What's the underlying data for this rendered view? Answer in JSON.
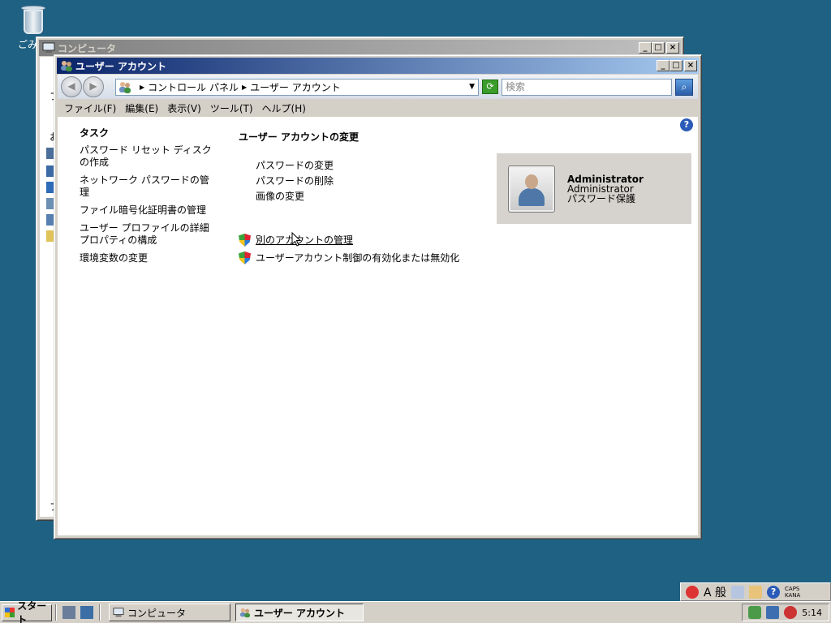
{
  "desktop": {
    "recycle_bin_label": "ごみ箱"
  },
  "back_window": {
    "title": "コンピュータ",
    "sliver_texts": [
      "フ",
      "お",
      "フ"
    ]
  },
  "window": {
    "title": "ユーザー アカウント",
    "controls": {
      "minimize": "_",
      "maximize": "□",
      "close": "×"
    }
  },
  "address_bar": {
    "crumbs": [
      "コントロール パネル",
      "ユーザー アカウント"
    ],
    "search_placeholder": "検索"
  },
  "menu": {
    "items": [
      "ファイル(F)",
      "編集(E)",
      "表示(V)",
      "ツール(T)",
      "ヘルプ(H)"
    ]
  },
  "tasks": {
    "heading": "タスク",
    "items": [
      "パスワード リセット ディスクの作成",
      "ネットワーク パスワードの管理",
      "ファイル暗号化証明書の管理",
      "ユーザー プロファイルの詳細プロパティの構成",
      "環境変数の変更"
    ]
  },
  "main": {
    "heading": "ユーザー アカウントの変更",
    "actions": [
      "パスワードの変更",
      "パスワードの削除",
      "画像の変更"
    ],
    "shield_actions": [
      "別のアカウントの管理",
      "ユーザーアカウント制御の有効化または無効化"
    ]
  },
  "user": {
    "name": "Administrator",
    "role": "Administrator",
    "status": "パスワード保護"
  },
  "language_bar": {
    "ime_label": "A 般",
    "caps": "CAPS",
    "kana": "KANA",
    "help": "?"
  },
  "taskbar": {
    "start_label": "スタート",
    "tasks": [
      "コンピュータ",
      "ユーザー アカウント"
    ],
    "clock": "5:14"
  }
}
